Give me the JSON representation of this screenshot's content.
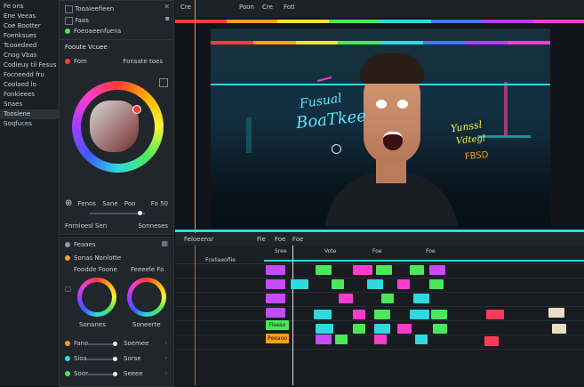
{
  "left_list": {
    "items": [
      "Fe ons",
      "Ene Veeas",
      "Coe Bootter",
      "Foenksues",
      "Tcooedeed",
      "Cnog Vbas",
      "Codieuy til Fesus",
      "Focneedd fru",
      "Coolaed lo",
      "Fonkieees",
      "Snaes",
      "Tooslene",
      "Soqfuces"
    ],
    "selected_index": 11
  },
  "top_panel": {
    "rows": [
      "Tooaieefieen",
      "Faas",
      "Foeoaeenfuens"
    ]
  },
  "color_panel": {
    "title": "Fooute Vcuee",
    "label_left": "Fom",
    "label_right": "Fonsate toes",
    "controls": {
      "c1": "Fenos",
      "c2": "Sane",
      "c3": "Poo",
      "c4": "Fo 50"
    },
    "footer_left": "Fnrnioesl Sen",
    "footer_right": "Sonneses",
    "dot_color": "#ff3b3b"
  },
  "wheels_panel": {
    "title": "Feaaes",
    "sub_title": "Sonas Nonlotte",
    "wheel1_label": "Foodde Foone",
    "wheel2_label": "Feeeele Fo",
    "wheel1_caption": "Sonanes",
    "wheel2_caption": "Soneerte",
    "sliders": [
      {
        "label": "Fano",
        "value_label": "Soemee"
      },
      {
        "label": "Sioa",
        "value_label": "Sorse"
      },
      {
        "label": "Soos",
        "value_label": "Seeee"
      }
    ]
  },
  "viewer": {
    "top_labels": [
      "Cre",
      "Poon",
      "Cre",
      "Fotl"
    ],
    "text_left_1": "Fusual",
    "text_left_2": "BoaTkee",
    "text_right_1": "Yunssl",
    "text_right_2": "Vdtegl",
    "text_right_3": "FBSD",
    "rainbow": [
      "#ff3b3b",
      "#ff9f1a",
      "#f5e03a",
      "#49e85a",
      "#2fd9e0",
      "#3a7bff",
      "#b43cff",
      "#ff3bcf"
    ]
  },
  "timeline": {
    "header_labels": [
      "Feloeensr",
      "Fie",
      "Foe",
      "Foe"
    ],
    "ruler": [
      "Fceliaeoflie",
      "Sree",
      "Vote",
      "Foe",
      "Foe"
    ],
    "clip_labels": {
      "a": "Fiseao",
      "b": "Peeaoo"
    }
  }
}
